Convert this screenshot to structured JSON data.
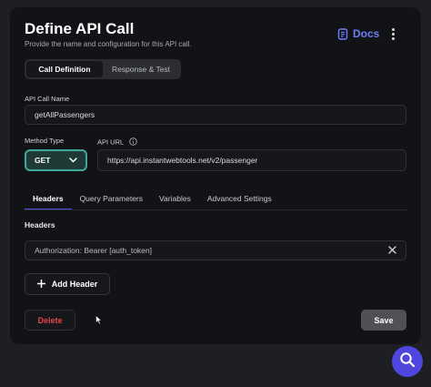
{
  "dialog": {
    "title": "Define API Call",
    "subtitle": "Provide the name and configuration for this API call.",
    "docs_label": "Docs"
  },
  "mode_tabs": [
    {
      "label": "Call Definition",
      "active": true
    },
    {
      "label": "Response & Test",
      "active": false
    }
  ],
  "fields": {
    "call_name_label": "API Call Name",
    "call_name_value": "getAllPassengers",
    "method_label": "Method Type",
    "method_value": "GET",
    "url_label": "API URL",
    "url_value": "https://api.instantwebtools.net/v2/passenger"
  },
  "config_tabs": [
    {
      "label": "Headers",
      "active": true
    },
    {
      "label": "Query Parameters",
      "active": false
    },
    {
      "label": "Variables",
      "active": false
    },
    {
      "label": "Advanced Settings",
      "active": false
    }
  ],
  "headers": {
    "section_label": "Headers",
    "items": [
      {
        "value": "Authorization: Bearer [auth_token]"
      }
    ],
    "add_label": "Add Header"
  },
  "actions": {
    "delete_label": "Delete",
    "save_label": "Save"
  },
  "colors": {
    "accent": "#6f7cf7",
    "method_border": "#3ea89b",
    "delete": "#e2474d",
    "fab": "#4e46dd"
  },
  "icons": {
    "docs": "docs-icon",
    "more": "more-vertical-icon",
    "info": "info-icon",
    "dropdown": "chevron-down-icon",
    "remove_header": "close-icon",
    "add": "plus-icon",
    "fab": "search-icon"
  }
}
